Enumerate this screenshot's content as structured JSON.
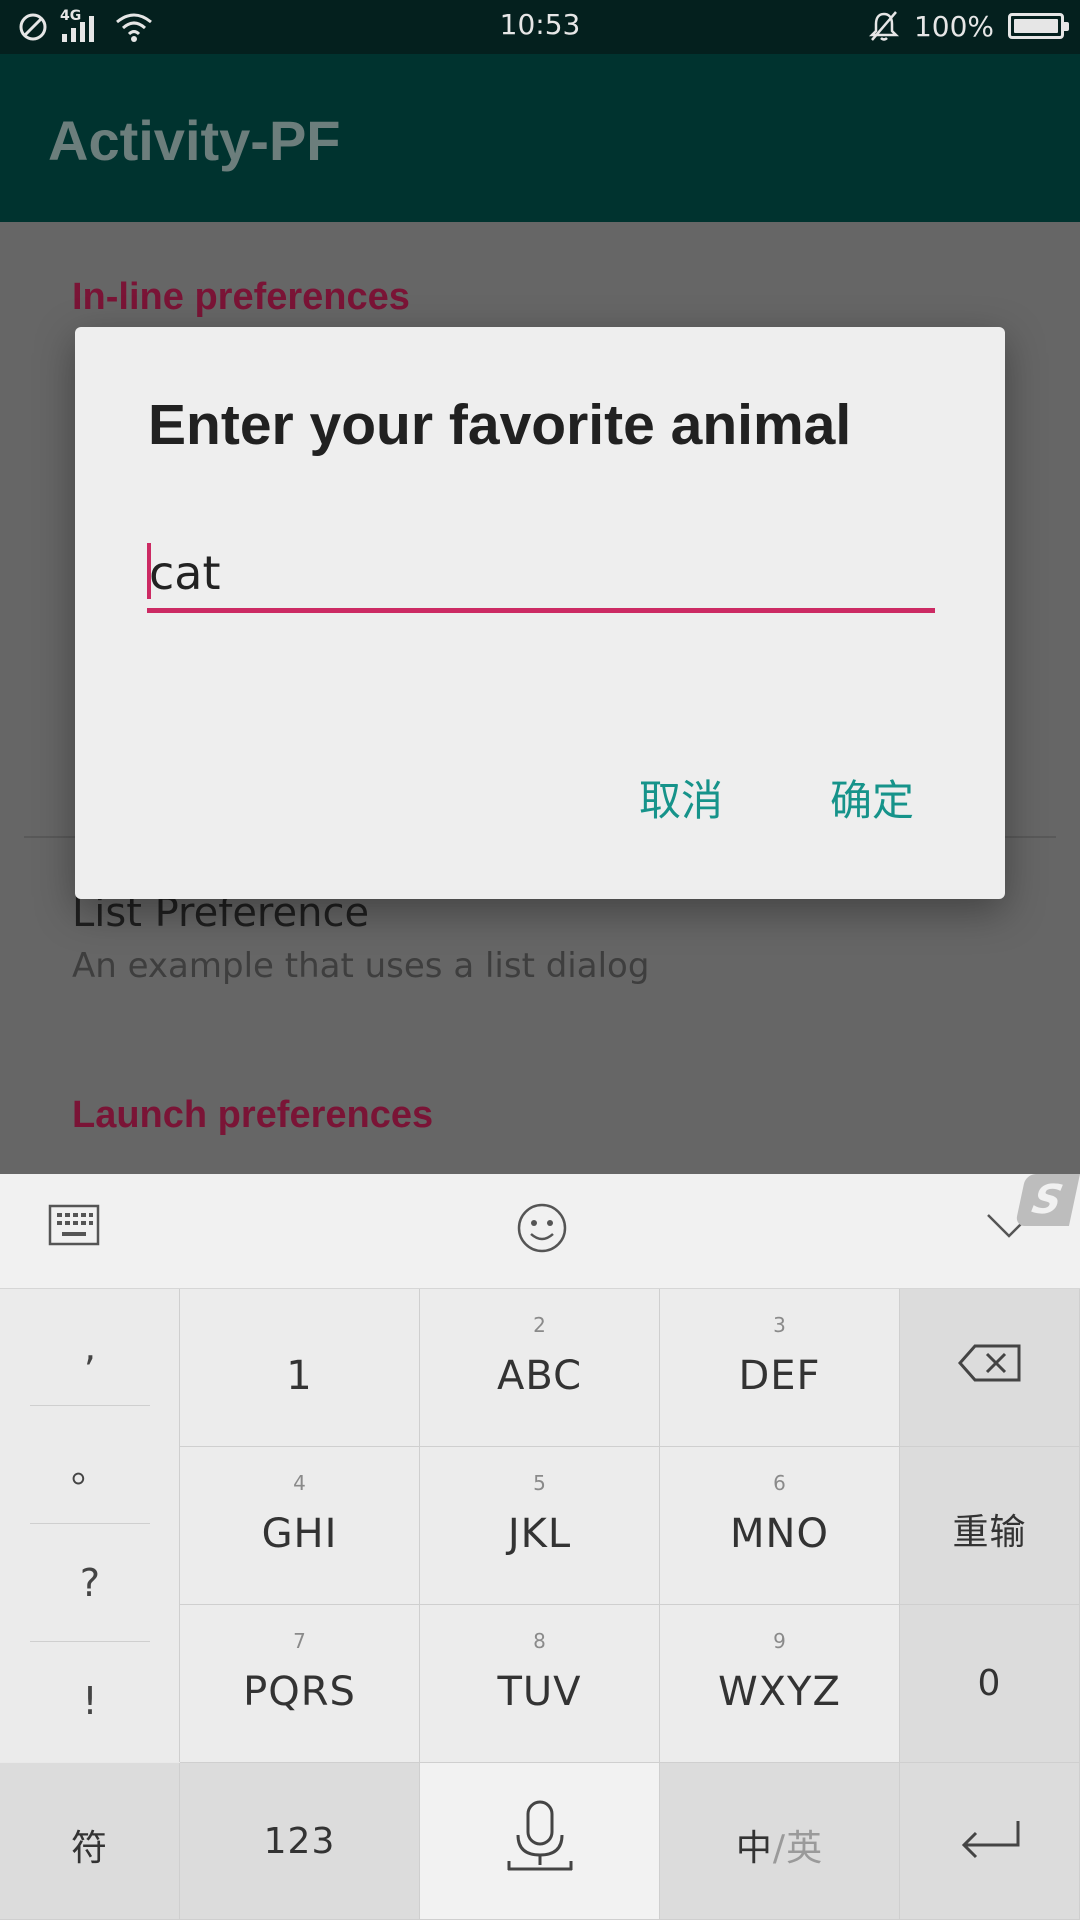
{
  "status_bar": {
    "network": "4G",
    "time": "10:53",
    "battery": "100%",
    "battery_level": 1.0,
    "icons": [
      "do-not-disturb-icon",
      "signal-icon",
      "wifi-icon",
      "bell-muted-icon",
      "battery-icon"
    ]
  },
  "app_bar": {
    "title": "Activity-PF"
  },
  "preferences": {
    "category_inline": "In-line preferences",
    "list_pref_title": "List Preference",
    "list_pref_summary": "An example that uses a list dialog",
    "category_launch": "Launch preferences"
  },
  "dialog": {
    "title": "Enter your favorite animal",
    "input_value": "cat",
    "cancel_label": "取消",
    "ok_label": "确定"
  },
  "keyboard": {
    "toolbar": {
      "icons": [
        "keyboard-icon",
        "emoji-icon",
        "collapse-icon"
      ],
      "logo": "S"
    },
    "punctuation": [
      ",",
      "。",
      "?",
      "!"
    ],
    "keys": [
      {
        "num": "",
        "label": "1"
      },
      {
        "num": "2",
        "label": "ABC"
      },
      {
        "num": "3",
        "label": "DEF"
      },
      {
        "num": "4",
        "label": "GHI"
      },
      {
        "num": "5",
        "label": "JKL"
      },
      {
        "num": "6",
        "label": "MNO"
      },
      {
        "num": "7",
        "label": "PQRS"
      },
      {
        "num": "8",
        "label": "TUV"
      },
      {
        "num": "9",
        "label": "WXYZ"
      }
    ],
    "side_keys": {
      "reenter": "重输",
      "zero": "0"
    },
    "bottom": {
      "symbols": "符",
      "num123": "123",
      "lang_zh": "中",
      "lang_sep": "/",
      "lang_en": "英"
    }
  },
  "colors": {
    "accent": "#cc2a63",
    "dialog_button": "#16938a",
    "app_bar": "#00332f",
    "category": "#7a1436"
  }
}
